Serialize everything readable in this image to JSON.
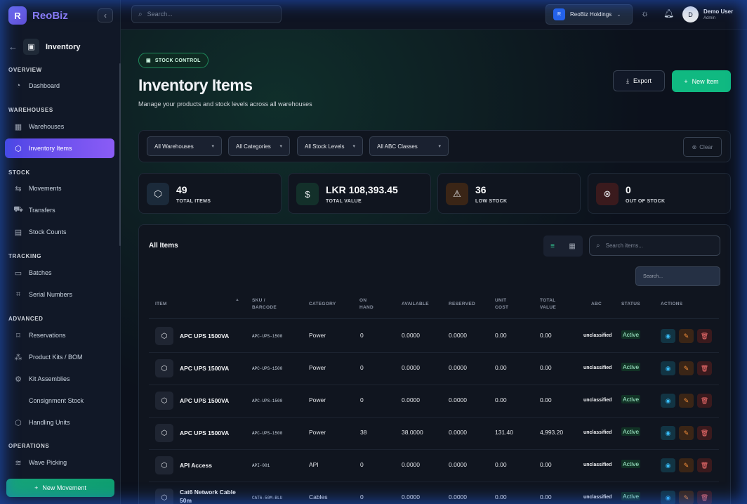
{
  "app": {
    "logo_letter": "R",
    "name": "ReoBiz",
    "collapse_icon": "‹"
  },
  "module": {
    "back_icon": "←",
    "title": "Inventory"
  },
  "sidebar": {
    "sections": [
      {
        "label": "OVERVIEW"
      },
      {
        "label": "WAREHOUSES"
      },
      {
        "label": "STOCK"
      },
      {
        "label": "TRACKING"
      },
      {
        "label": "ADVANCED"
      },
      {
        "label": "OPERATIONS"
      }
    ],
    "items": [
      {
        "label": "Dashboard",
        "icon": "dashboard-icon"
      },
      {
        "label": "Warehouses",
        "icon": "warehouse-icon"
      },
      {
        "label": "Inventory Items",
        "icon": "box-icon",
        "active": true
      },
      {
        "label": "Movements",
        "icon": "arrows-icon"
      },
      {
        "label": "Transfers",
        "icon": "truck-icon"
      },
      {
        "label": "Stock Counts",
        "icon": "clipboard-icon"
      },
      {
        "label": "Batches",
        "icon": "layers-icon"
      },
      {
        "label": "Serial Numbers",
        "icon": "scan-icon"
      },
      {
        "label": "Reservations",
        "icon": "bookmark-icon"
      },
      {
        "label": "Product Kits / BOM",
        "icon": "cubes-icon"
      },
      {
        "label": "Kit Assemblies",
        "icon": "cog-icon"
      },
      {
        "label": "Consignment Stock",
        "icon": ""
      },
      {
        "label": "Handling Units",
        "icon": "package-icon"
      },
      {
        "label": "Wave Picking",
        "icon": "stack-icon"
      }
    ],
    "new_movement": "New Movement"
  },
  "topbar": {
    "search_placeholder": "Search...",
    "org": {
      "badge": "R",
      "name": "ReoBiz Holdings"
    },
    "user": {
      "initial": "D",
      "name": "Demo User",
      "role": "Admin"
    }
  },
  "page": {
    "badge": "STOCK CONTROL",
    "title": "Inventory Items",
    "subtitle": "Manage your products and stock levels across all warehouses",
    "export_label": "Export",
    "new_item_label": "New Item"
  },
  "filters": {
    "warehouse": "All Warehouses",
    "category": "All Categories",
    "stock_level": "All Stock Levels",
    "abc": "All ABC Classes",
    "clear": "Clear"
  },
  "stats": [
    {
      "value": "49",
      "label": "TOTAL ITEMS",
      "color": "#60a5fa"
    },
    {
      "value": "LKR 108,393.45",
      "label": "TOTAL VALUE",
      "color": "#34d399"
    },
    {
      "value": "36",
      "label": "LOW STOCK",
      "color": "#fb923c"
    },
    {
      "value": "0",
      "label": "OUT OF STOCK",
      "color": "#f87171"
    }
  ],
  "table": {
    "title": "All Items",
    "search_placeholder": "Search items...",
    "column_search_placeholder": "Search...",
    "headers": [
      "ITEM",
      "SKU / BARCODE",
      "CATEGORY",
      "ON HAND",
      "AVAILABLE",
      "RESERVED",
      "UNIT COST",
      "TOTAL VALUE",
      "ABC",
      "STATUS",
      "ACTIONS"
    ],
    "rows": [
      {
        "item": "APC UPS 1500VA",
        "sku": "APC-UPS-1500",
        "category": "Power",
        "on_hand": "0",
        "available": "0.0000",
        "reserved": "0.0000",
        "unit_cost": "0.00",
        "total": "0.00",
        "abc": "unclassified",
        "status": "Active"
      },
      {
        "item": "APC UPS 1500VA",
        "sku": "APC-UPS-1500",
        "category": "Power",
        "on_hand": "0",
        "available": "0.0000",
        "reserved": "0.0000",
        "unit_cost": "0.00",
        "total": "0.00",
        "abc": "unclassified",
        "status": "Active"
      },
      {
        "item": "APC UPS 1500VA",
        "sku": "APC-UPS-1500",
        "category": "Power",
        "on_hand": "0",
        "available": "0.0000",
        "reserved": "0.0000",
        "unit_cost": "0.00",
        "total": "0.00",
        "abc": "unclassified",
        "status": "Active"
      },
      {
        "item": "APC UPS 1500VA",
        "sku": "APC-UPS-1500",
        "category": "Power",
        "on_hand": "38",
        "available": "38.0000",
        "reserved": "0.0000",
        "unit_cost": "131.40",
        "total": "4,993.20",
        "abc": "unclassified",
        "status": "Active"
      },
      {
        "item": "API Access",
        "sku": "API-001",
        "category": "API",
        "on_hand": "0",
        "available": "0.0000",
        "reserved": "0.0000",
        "unit_cost": "0.00",
        "total": "0.00",
        "abc": "unclassified",
        "status": "Active"
      },
      {
        "item": "Cat6 Network Cable 50m",
        "sku": "CAT6-50M-BLU",
        "category": "Cables",
        "on_hand": "0",
        "available": "0.0000",
        "reserved": "0.0000",
        "unit_cost": "0.00",
        "total": "0.00",
        "abc": "unclassified",
        "status": "Active"
      }
    ]
  }
}
